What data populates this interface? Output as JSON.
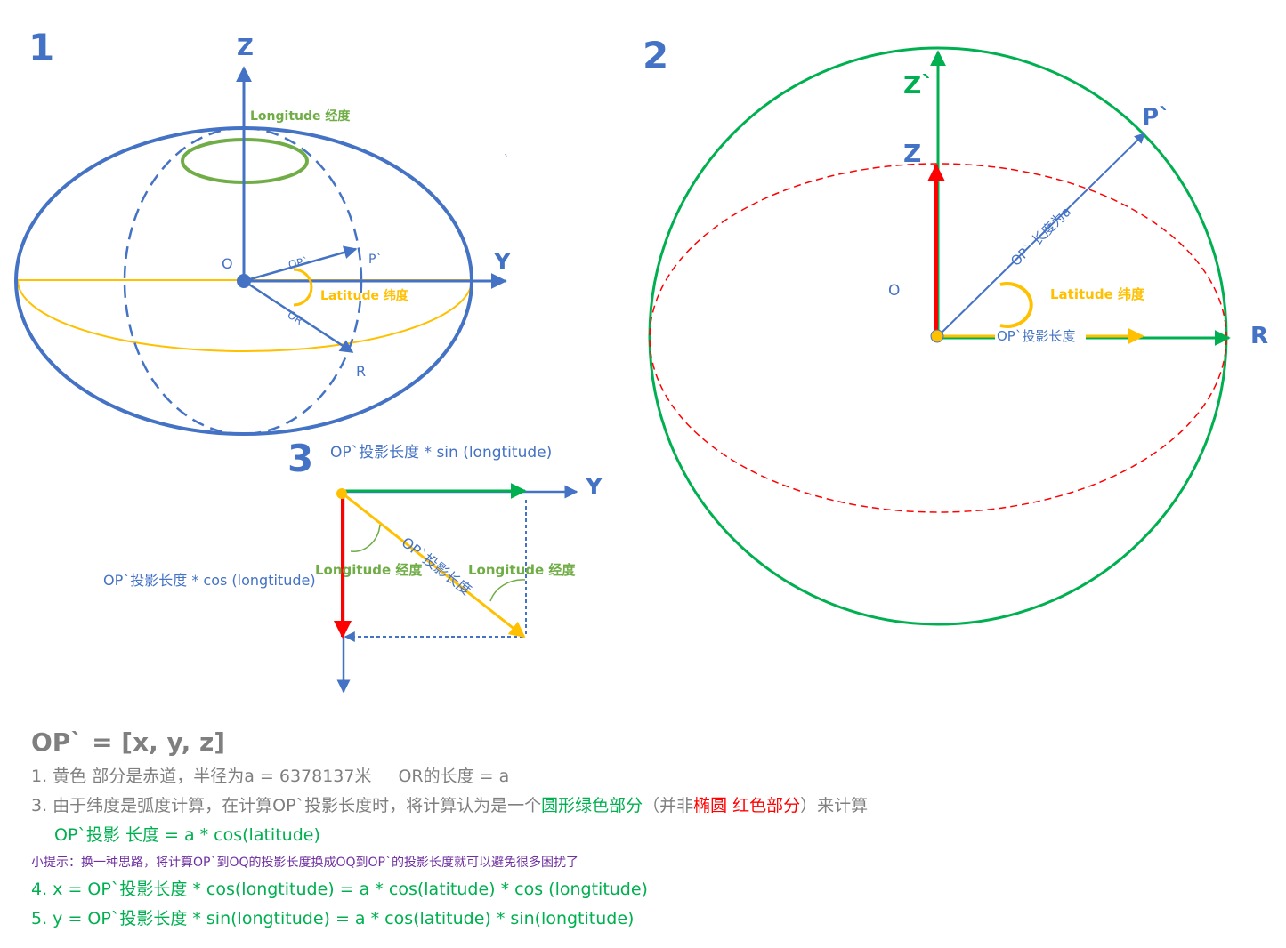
{
  "colors": {
    "blue": "#4472c4",
    "green": "#00b050",
    "yellow": "#ffc000",
    "red": "#ff0000",
    "olive_green": "#70ad47",
    "gray": "#7f7f7f",
    "purple": "#7030a0"
  },
  "panel1": {
    "number": "1",
    "axis_z": "Z",
    "axis_y": "Y",
    "origin": "O",
    "longitude_label": "Longitude 经度",
    "latitude_label": "Latitude 纬度",
    "op_label": "OP`",
    "p_label": "P`",
    "or_label": "OR",
    "r_label": "R",
    "stray_mark": "`"
  },
  "panel2": {
    "number": "2",
    "axis_z_prime": "Z`",
    "axis_z": "Z",
    "p_label": "P`",
    "origin": "O",
    "r_label": "R",
    "op_length_label": "OP` 长度为a",
    "latitude_label": "Latitude 纬度",
    "projection_label": "OP`投影长度"
  },
  "panel3": {
    "number": "3",
    "axis_y": "Y",
    "sin_label": "OP`投影长度 * sin (longtitude)",
    "cos_label": "OP`投影长度 * cos (longtitude)",
    "projection_label": "OP`投影长度",
    "longitude_label_left": "Longitude 经度",
    "longitude_label_right": "Longitude 经度"
  },
  "notes": {
    "formula": "OP` = [x, y, z]",
    "line1_a": "1. 黄色 部分是赤道，半径为a = 6378137米",
    "line1_b": "OR的长度 = a",
    "line3_a": "3. 由于纬度是弧度计算，在计算OP`投影长度时，将计算认为是一个",
    "line3_green": "圆形绿色部分",
    "line3_b": "（并非",
    "line3_red": "椭圆 红色部分",
    "line3_c": "）来计算",
    "line3_formula": "OP`投影 长度 = a * cos(latitude)",
    "tip": "小提示：换一种思路，将计算OP`到OQ的投影长度换成OQ到OP`的投影长度就可以避免很多困扰了",
    "line4": "4. x = OP`投影长度 * cos(longtitude) = a * cos(latitude) * cos (longtitude)",
    "line5": "5. y = OP`投影长度 * sin(longtitude) = a * cos(latitude) * sin(longtitude)"
  }
}
